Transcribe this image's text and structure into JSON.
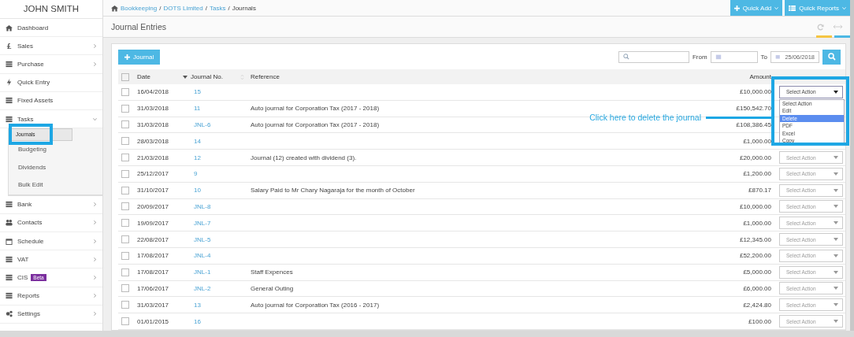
{
  "user": {
    "name": "JOHN SMITH"
  },
  "sidebar": {
    "items": [
      {
        "label": "Dashboard",
        "submenu": false
      },
      {
        "label": "Sales",
        "submenu": true
      },
      {
        "label": "Purchase",
        "submenu": true
      },
      {
        "label": "Quick Entry",
        "submenu": false
      },
      {
        "label": "Fixed Assets",
        "submenu": false
      },
      {
        "label": "Tasks",
        "submenu": true,
        "expanded": true,
        "children": [
          {
            "label": "Journals",
            "selected": true
          },
          {
            "label": "Budgeting",
            "selected": false
          },
          {
            "label": "Dividends",
            "selected": false
          },
          {
            "label": "Bulk Edit",
            "selected": false
          }
        ]
      },
      {
        "label": "Bank",
        "submenu": true
      },
      {
        "label": "Contacts",
        "submenu": true
      },
      {
        "label": "Schedule",
        "submenu": true
      },
      {
        "label": "VAT",
        "submenu": true
      },
      {
        "label": "CIS",
        "submenu": true,
        "badge": "Beta"
      },
      {
        "label": "Reports",
        "submenu": true
      },
      {
        "label": "Settings",
        "submenu": true
      }
    ]
  },
  "breadcrumb": {
    "separator": "/",
    "items": [
      "Bookkeeping",
      "DOTS Limited",
      "Tasks",
      "Journals"
    ]
  },
  "header_buttons": [
    {
      "label": "Quick Add"
    },
    {
      "label": "Quick Reports"
    }
  ],
  "page_title": "Journal Entries",
  "toolbar": {
    "add_button": "Journal",
    "from_label": "From",
    "to_label": "To",
    "to_value": "25/06/2018"
  },
  "table": {
    "all_checked": false,
    "columns": [
      "Date",
      "Journal No.",
      "Reference",
      "Amount"
    ],
    "rows": [
      {
        "date": "16/04/2018",
        "journal_no": "15",
        "amount": "£10,000.00",
        "checked": false
      },
      {
        "date": "31/03/2018",
        "journal_no": "11",
        "reference": "Auto journal for Corporation Tax (2017 - 2018)",
        "amount": "£150,542.70",
        "checked": false
      },
      {
        "date": "31/03/2018",
        "journal_no": "JNL-6",
        "reference": "Auto journal for Corporation Tax (2017 - 2018)",
        "amount": "£108,386.45",
        "checked": false
      },
      {
        "date": "28/03/2018",
        "journal_no": "14",
        "amount": "£1,000.00",
        "checked": false
      },
      {
        "date": "21/03/2018",
        "journal_no": "12",
        "reference": "Journal (12) created with dividend (3).",
        "amount": "£20,000.00",
        "action": "Select Action",
        "checked": false
      },
      {
        "date": "25/12/2017",
        "journal_no": "9",
        "amount": "£1,200.00",
        "action": "Select Action",
        "checked": false
      },
      {
        "date": "31/10/2017",
        "journal_no": "10",
        "reference": "Salary Paid to Mr Chary Nagaraja for the month of October",
        "amount": "£870.17",
        "action": "Select Action",
        "checked": false
      },
      {
        "date": "20/09/2017",
        "journal_no": "JNL-8",
        "amount": "£10,000.00",
        "action": "Select Action",
        "checked": false
      },
      {
        "date": "19/09/2017",
        "journal_no": "JNL-7",
        "amount": "£1,000.00",
        "action": "Select Action",
        "checked": false
      },
      {
        "date": "22/08/2017",
        "journal_no": "JNL-5",
        "amount": "£12,345.00",
        "action": "Select Action",
        "checked": false
      },
      {
        "date": "17/08/2017",
        "journal_no": "JNL-4",
        "amount": "£52,200.00",
        "action": "Select Action",
        "checked": false
      },
      {
        "date": "17/08/2017",
        "journal_no": "JNL-1",
        "reference": "Staff Expences",
        "amount": "£5,000.00",
        "action": "Select Action",
        "checked": false
      },
      {
        "date": "17/06/2017",
        "journal_no": "JNL-2",
        "reference": "General Outing",
        "amount": "£6,000.00",
        "action": "Select Action",
        "checked": false
      },
      {
        "date": "31/03/2017",
        "journal_no": "13",
        "reference": "Auto journal for Corporation Tax (2016 - 2017)",
        "amount": "£2,424.80",
        "action": "Select Action",
        "checked": false
      },
      {
        "date": "01/01/2015",
        "journal_no": "16",
        "amount": "£100.00",
        "action": "Select Action",
        "checked": false
      }
    ]
  },
  "open_dropdown": {
    "value": "Select Action",
    "options": [
      {
        "label": "Select Action",
        "highlighted": false
      },
      {
        "label": "Edit",
        "highlighted": false
      },
      {
        "label": "Delete",
        "highlighted": true
      },
      {
        "label": "PDF",
        "highlighted": false
      },
      {
        "label": "Excel",
        "highlighted": false
      },
      {
        "label": "Copy",
        "highlighted": false
      }
    ]
  },
  "annotation": {
    "callout": "Click here to delete the journal"
  }
}
